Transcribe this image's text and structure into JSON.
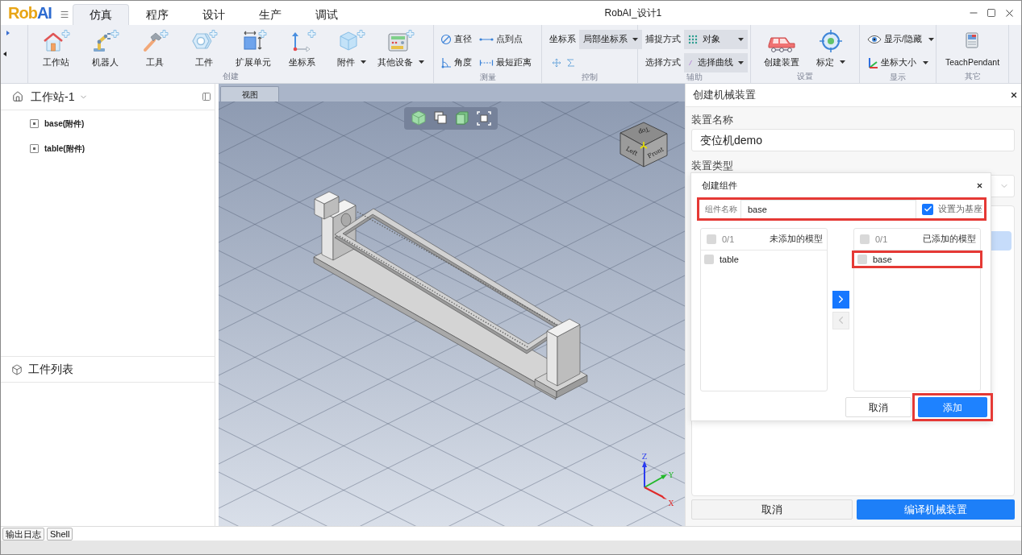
{
  "app": {
    "logo": [
      {
        "text": "Rob",
        "color": "#e8a516"
      },
      {
        "text": "AI",
        "color": "#2d6bd0"
      }
    ],
    "title": "RobAI_设计1"
  },
  "menu_tabs": [
    {
      "label": "仿真",
      "selected": true
    },
    {
      "label": "程序",
      "selected": false
    },
    {
      "label": "设计",
      "selected": false
    },
    {
      "label": "生产",
      "selected": false
    },
    {
      "label": "调试",
      "selected": false
    }
  ],
  "ribbon": [
    {
      "label": "创建",
      "rows": [
        [
          {
            "kind": "large",
            "label": "工作站",
            "dropdown": false
          },
          {
            "kind": "large",
            "label": "机器人",
            "dropdown": false
          },
          {
            "kind": "large",
            "label": "工具",
            "dropdown": false
          },
          {
            "kind": "large",
            "label": "工件",
            "dropdown": false
          },
          {
            "kind": "large",
            "label": "扩展单元",
            "dropdown": false
          },
          {
            "kind": "large",
            "label": "坐标系",
            "dropdown": false
          },
          {
            "kind": "large",
            "label": "附件",
            "dropdown": true
          },
          {
            "kind": "large",
            "label": "其他设备",
            "dropdown": true
          }
        ]
      ]
    },
    {
      "label": "测量",
      "rows": [
        [
          {
            "kind": "small",
            "label": "直径",
            "dropdown": false
          },
          {
            "kind": "small",
            "label": "点到点",
            "dropdown": false
          }
        ],
        [
          {
            "kind": "small",
            "label": "角度",
            "dropdown": false
          },
          {
            "kind": "small",
            "label": "最短距离",
            "dropdown": false
          }
        ]
      ]
    },
    {
      "label": "控制",
      "rows": [
        [
          {
            "kind": "select",
            "label": "坐标系",
            "value": "局部坐标系"
          }
        ],
        [
          {
            "kind": "tool"
          },
          {
            "kind": "tool"
          }
        ]
      ]
    },
    {
      "label": "辅助",
      "rows": [
        [
          {
            "kind": "select",
            "label": "捕捉方式",
            "value": "对象"
          }
        ],
        [
          {
            "kind": "select",
            "label": "选择方式",
            "value": "选择曲线"
          }
        ]
      ]
    },
    {
      "label": "设置",
      "rows": [
        [
          {
            "kind": "large",
            "label": "创建装置",
            "dropdown": false
          },
          {
            "kind": "large",
            "label": "标定",
            "dropdown": true
          }
        ]
      ]
    },
    {
      "label": "显示",
      "rows": [
        [
          {
            "kind": "small",
            "label": "显示/隐藏",
            "dropdown": true
          }
        ],
        [
          {
            "kind": "small",
            "label": "坐标大小",
            "dropdown": true
          }
        ]
      ]
    },
    {
      "label": "其它",
      "rows": [
        [
          {
            "kind": "large",
            "label": "TeachPendant",
            "dropdown": false
          }
        ]
      ]
    }
  ],
  "workstation": {
    "title": "工作站-1",
    "items": [
      {
        "label": "base(附件)"
      },
      {
        "label": "table(附件)"
      }
    ]
  },
  "workpieces": {
    "title": "工件列表"
  },
  "viewport": {
    "tab": "视图",
    "view_cube": [
      {
        "kind": "top",
        "label": "Top"
      },
      {
        "kind": "left",
        "label": "Left"
      },
      {
        "kind": "front",
        "label": "Front"
      }
    ],
    "axes": [
      {
        "kind": "z",
        "label": "Z",
        "color": "#2b3cf0"
      },
      {
        "kind": "y",
        "label": "Y",
        "color": "#22b82a"
      },
      {
        "kind": "x",
        "label": "X",
        "color": "#e02a2a"
      }
    ]
  },
  "device_panel": {
    "title": "创建机械装置",
    "fields": [
      {
        "kind": "input",
        "label": "装置名称",
        "value": "变位机demo"
      },
      {
        "kind": "select",
        "label": "装置类型"
      }
    ],
    "buttons": [
      {
        "label": "取消",
        "kind": "default"
      },
      {
        "label": "编译机械装置",
        "kind": "primary"
      }
    ]
  },
  "component_dialog": {
    "title": "创建组件",
    "name_field": {
      "label": "组件名称",
      "value": "base",
      "highlighted": true
    },
    "set_as_base": {
      "label": "设置为基座",
      "checked": true
    },
    "lists": [
      {
        "count": "0/1",
        "title": "未添加的模型",
        "checked": false,
        "items": [
          {
            "label": "table",
            "checked": false,
            "highlighted": false
          }
        ]
      },
      {
        "count": "0/1",
        "title": "已添加的模型",
        "checked": false,
        "items": [
          {
            "label": "base",
            "checked": false,
            "highlighted": true
          }
        ]
      }
    ],
    "transfer_buttons": [
      {
        "kind": "right",
        "disabled": false
      },
      {
        "kind": "left",
        "disabled": true
      }
    ],
    "buttons": [
      {
        "label": "取消",
        "kind": "default",
        "highlighted": false
      },
      {
        "label": "添加",
        "kind": "primary",
        "highlighted": true
      }
    ]
  },
  "output_tabs": [
    {
      "label": "输出日志"
    },
    {
      "label": "Shell"
    }
  ]
}
